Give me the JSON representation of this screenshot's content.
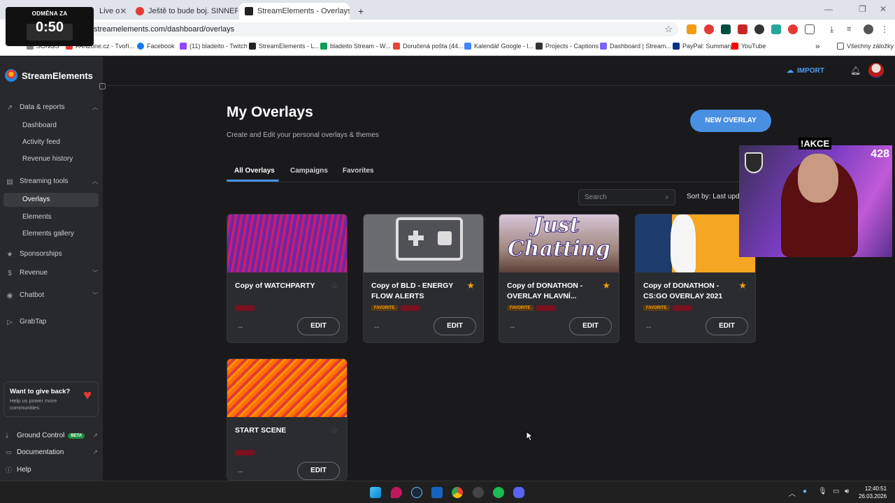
{
  "timer": {
    "label": "ODMĚNA ZA",
    "value": "0:50"
  },
  "browser": {
    "tabs": [
      {
        "label": "Live o",
        "fav_color": "#9146ff"
      },
      {
        "label": "Ještě to bude boj. SINNERS pot",
        "fav_color": "#e53935"
      },
      {
        "label": "StreamElements - Overlays",
        "fav_color": "#222222"
      }
    ],
    "new_tab": "+",
    "url": "streamelements.com/dashboard/overlays",
    "bookmarks": [
      {
        "label": "SONGS",
        "color": "#888888"
      },
      {
        "label": "FANzone.cz - Tvoří...",
        "color": "#e53935"
      },
      {
        "label": "Facebook",
        "color": "#1877f2"
      },
      {
        "label": "(11) bladeito - Twitch",
        "color": "#9146ff"
      },
      {
        "label": "StreamElements - L...",
        "color": "#222222"
      },
      {
        "label": "bladeito Stream - W...",
        "color": "#0f9d58"
      },
      {
        "label": "Doručená pošta (44...",
        "color": "#ea4335"
      },
      {
        "label": "Kalendář Google - l...",
        "color": "#4285f4"
      },
      {
        "label": "Projects - Captions",
        "color": "#333333"
      },
      {
        "label": "Dashboard | Stream...",
        "color": "#7b61ff"
      },
      {
        "label": "PayPal: Summary",
        "color": "#003087"
      },
      {
        "label": "YouTube",
        "color": "#ff0000"
      }
    ],
    "more": "»",
    "all_bookmarks": "Všechny záložky"
  },
  "sidebar": {
    "brand": "StreamElements",
    "sections": [
      {
        "label": "Data & reports",
        "icon": "chart-line-icon",
        "items": [
          "Dashboard",
          "Activity feed",
          "Revenue history"
        ]
      },
      {
        "label": "Streaming tools",
        "icon": "tools-icon",
        "items": [
          "Overlays",
          "Elements",
          "Elements gallery"
        ]
      }
    ],
    "sponsorships": "Sponsorships",
    "revenue": "Revenue",
    "chatbot": "Chatbot",
    "grabtap": "GrabTap",
    "giveback": {
      "title": "Want to give back?",
      "text": "Help us power more communities"
    },
    "ground_control": "Ground Control",
    "beta": "BETA",
    "documentation": "Documentation",
    "help": "Help"
  },
  "topbar": {
    "import": "IMPORT"
  },
  "page": {
    "title": "My Overlays",
    "subtitle": "Create and Edit your personal overlays & themes",
    "new_overlay": "NEW OVERLAY",
    "tabs": [
      "All Overlays",
      "Campaigns",
      "Favorites"
    ],
    "search_placeholder": "Search",
    "sort": "Sort by: Last upd"
  },
  "cards": [
    {
      "title": "Copy of WATCHPARTY",
      "favorite": false,
      "fav_tag": "",
      "edit": "EDIT",
      "dots": "···"
    },
    {
      "title": "Copy of BLD - ENERGY FLOW ALERTS",
      "favorite": true,
      "fav_tag": "FAVORITE",
      "edit": "EDIT",
      "dots": "···"
    },
    {
      "title": "Copy of DONATHON - OVERLAY HLAVNÍ...",
      "favorite": true,
      "fav_tag": "FAVORITE",
      "edit": "EDIT",
      "dots": "···"
    },
    {
      "title": "Copy of DONATHON - CS:GO OVERLAY 2021",
      "favorite": true,
      "fav_tag": "FAVORITE",
      "edit": "EDIT",
      "dots": "···"
    },
    {
      "title": "START SCENE",
      "favorite": false,
      "fav_tag": "",
      "edit": "EDIT",
      "dots": "···"
    }
  ],
  "thumb_text": {
    "just": "Just",
    "chatting": "Chatting"
  },
  "webcam": {
    "akce": "!AKCE",
    "viewers": "428"
  },
  "taskbar": {
    "time": "12:40:51",
    "date": "26.03.2026"
  },
  "colors": {
    "accent": "#4a90e2",
    "favorite_star": "#f39c12",
    "bg": "#1a1a1c",
    "sidebar": "#28292c"
  }
}
